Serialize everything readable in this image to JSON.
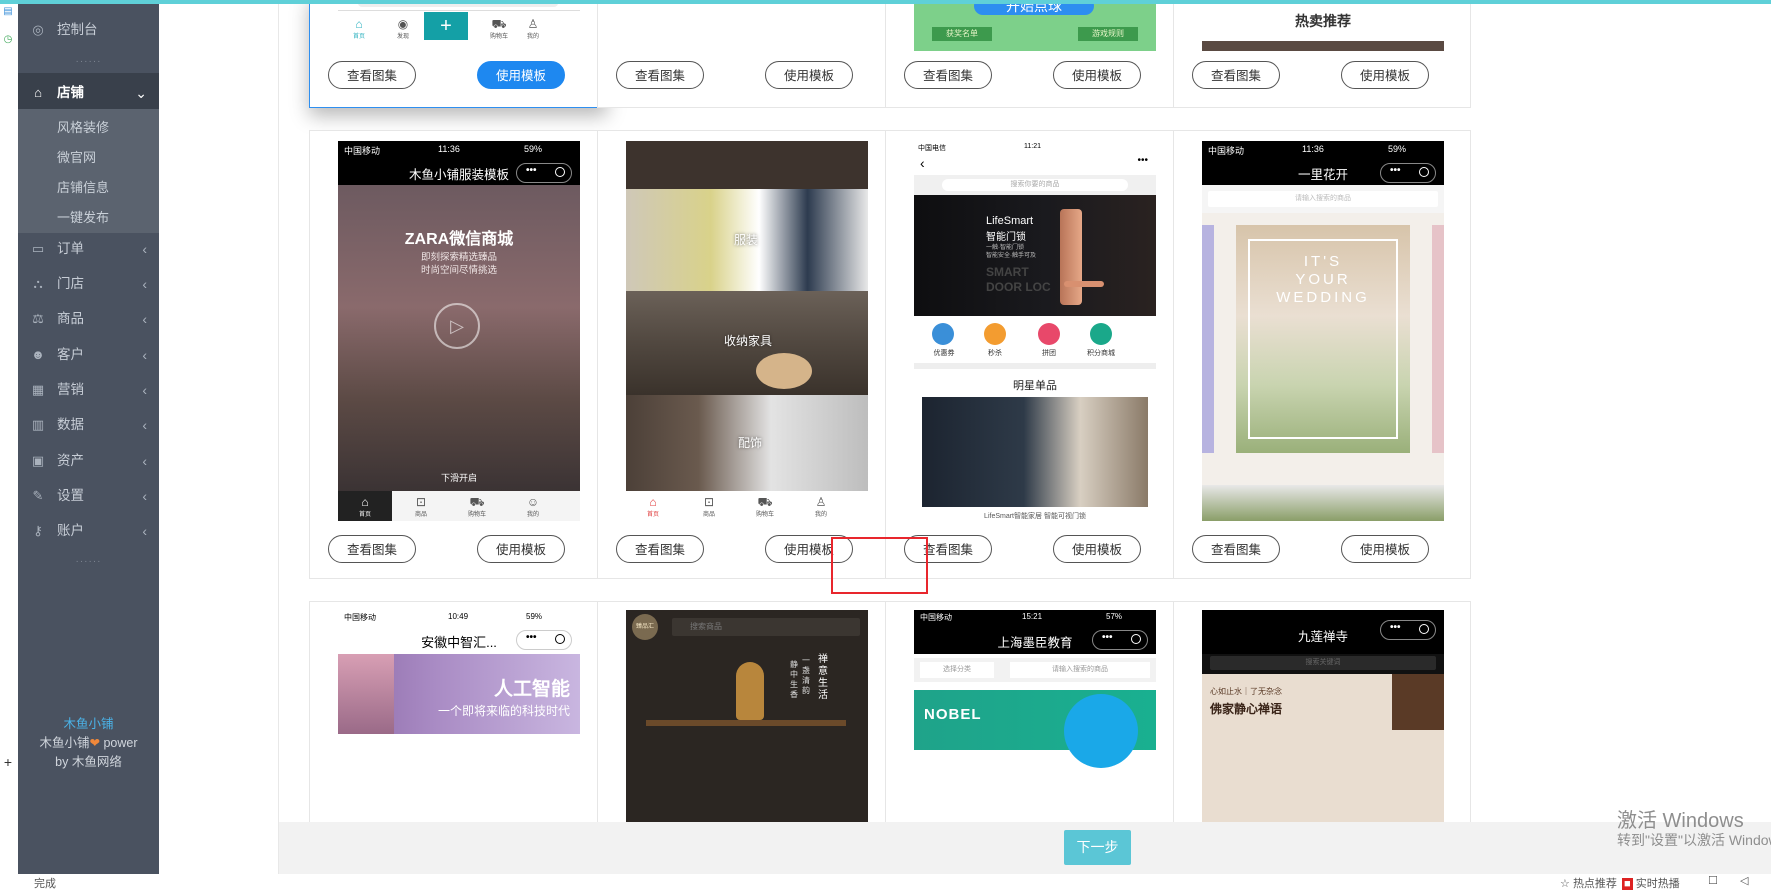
{
  "sidebar": {
    "dashboard": "控制台",
    "dots": "······",
    "shop": "店铺",
    "shop_sub": [
      "风格装修",
      "微官网",
      "店铺信息",
      "一键发布"
    ],
    "menu": [
      {
        "label": "订单",
        "icon": "order-icon"
      },
      {
        "label": "门店",
        "icon": "store-icon"
      },
      {
        "label": "商品",
        "icon": "scale-icon"
      },
      {
        "label": "客户",
        "icon": "users-icon"
      },
      {
        "label": "营销",
        "icon": "marketing-icon"
      },
      {
        "label": "数据",
        "icon": "chart-icon"
      },
      {
        "label": "资产",
        "icon": "asset-icon"
      },
      {
        "label": "设置",
        "icon": "wrench-icon"
      },
      {
        "label": "账户",
        "icon": "key-icon"
      }
    ],
    "footer_brand": "木鱼小铺",
    "footer_line2": "木鱼小铺",
    "footer_heart": "❤",
    "footer_power": " power",
    "footer_line3": "by 木鱼网络"
  },
  "buttons": {
    "view_gallery": "查看图集",
    "use_template": "使用模板",
    "next": "下一步"
  },
  "row0": {
    "c0_tabs": [
      "首页",
      "发现",
      "",
      "购物车",
      "我的"
    ],
    "c2_banner": "开始点球",
    "c2_tag_left": "获奖名单",
    "c2_tag_right": "游戏规则",
    "c3_title": "热卖推荐"
  },
  "row1": {
    "c0": {
      "carrier": "中国移动",
      "time": "11:36",
      "battery": "59%",
      "title": "木鱼小铺服装模板",
      "headline": "ZARA微信商城",
      "sub1": "即刻探索精选臻品",
      "sub2": "时尚空间尽情挑选",
      "bottom_text": "下滑开启",
      "tabs": [
        "首页",
        "商品",
        "购物车",
        "我的"
      ]
    },
    "c1": {
      "label1": "服装",
      "label2": "收纳家具",
      "label3": "配饰",
      "tabs": [
        "首页",
        "商品",
        "购物车",
        "我的"
      ]
    },
    "c2": {
      "carrier": "中国电信",
      "time": "11:21",
      "search": "搜索你要的商品",
      "brand": "LifeSmart",
      "brand_sub": "智能门锁",
      "brand_desc1": "一触·智能门锁",
      "brand_desc2": "智能安全·触手可及",
      "bg_text1": "SMART",
      "bg_text2": "DOOR LOC",
      "icons": [
        "优惠券",
        "秒杀",
        "拼团",
        "积分商城"
      ],
      "section": "明星单品",
      "footer": "LifeSmart智能家居 智能可视门锁"
    },
    "c3": {
      "carrier": "中国移动",
      "time": "11:36",
      "battery": "59%",
      "title": "一里花开",
      "search": "请输入搜索的商品",
      "poster_lines": [
        "IT'S",
        "YOUR",
        "WEDDING"
      ]
    }
  },
  "row2": {
    "c0": {
      "carrier": "中国移动",
      "time": "10:49",
      "battery": "59%",
      "title": "安徽中智汇...",
      "headline": "人工智能",
      "sub": "一个即将来临的科技时代"
    },
    "c1": {
      "search": "搜索商品",
      "vertical1": "禅意生活",
      "vertical2": "一盏清韵",
      "vertical3": "静中生香",
      "logo": "臻品汇"
    },
    "c2": {
      "carrier": "中国移动",
      "time": "15:21",
      "battery": "57%",
      "title": "上海墨臣教育",
      "select": "选择分类",
      "search": "请输入搜索的商品",
      "brand": "NOBEL"
    },
    "c3": {
      "title": "九莲禅寺",
      "search": "搜索关键词",
      "text1": "心如止水｜了无杂念",
      "text2": "佛家静心禅语"
    }
  },
  "watermark": {
    "line1": "激活 Windows",
    "line2": "转到\"设置\"以激活 Windows。"
  },
  "statusbar": {
    "done": "完成",
    "hot": "热点推荐",
    "live": "实时热播"
  },
  "colors": {
    "sidebar_bg": "#4a5260",
    "primary": "#1e88f0",
    "next_btn": "#5bc6d6",
    "highlight": "#e8262d"
  }
}
